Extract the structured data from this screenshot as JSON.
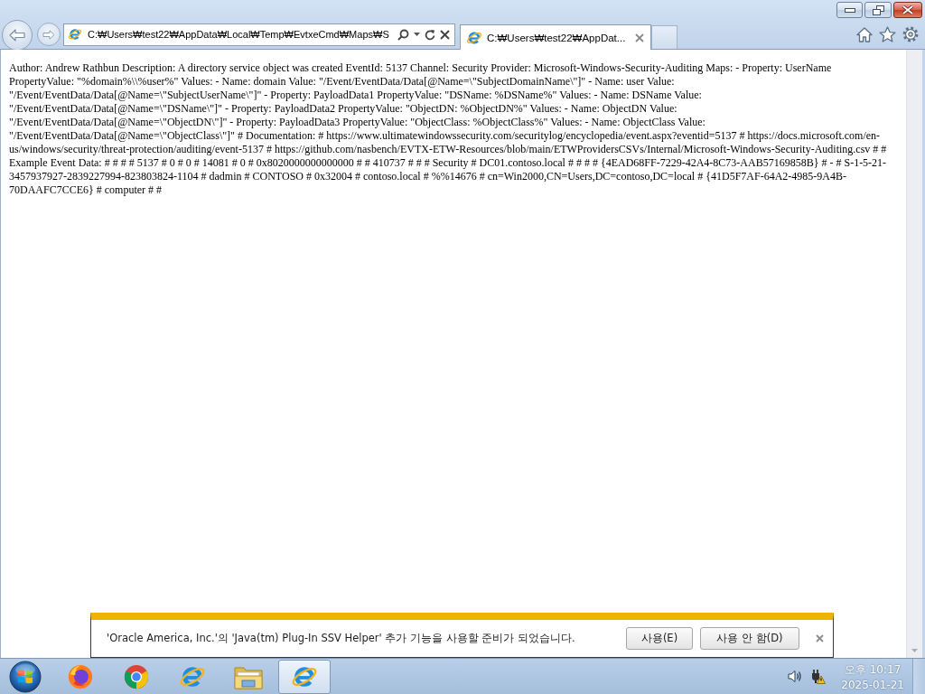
{
  "address_bar": {
    "value": "C:₩Users₩test22₩AppData₩Local₩Temp₩EvtxeCmd₩Maps₩S"
  },
  "tabs": [
    {
      "label": "C:₩Users₩test22₩AppDat...",
      "selected": true
    }
  ],
  "document": {
    "text": "Author: Andrew Rathbun Description: A directory service object was created EventId: 5137 Channel: Security Provider: Microsoft-Windows-Security-Auditing Maps: - Property: UserName PropertyValue: \"%domain%\\\\%user%\" Values: - Name: domain Value: \"/Event/EventData/Data[@Name=\\\"SubjectDomainName\\\"]\" - Name: user Value: \"/Event/EventData/Data[@Name=\\\"SubjectUserName\\\"]\" - Property: PayloadData1 PropertyValue: \"DSName: %DSName%\" Values: - Name: DSName Value: \"/Event/EventData/Data[@Name=\\\"DSName\\\"]\" - Property: PayloadData2 PropertyValue: \"ObjectDN: %ObjectDN%\" Values: - Name: ObjectDN Value: \"/Event/EventData/Data[@Name=\\\"ObjectDN\\\"]\" - Property: PayloadData3 PropertyValue: \"ObjectClass: %ObjectClass%\" Values: - Name: ObjectClass Value: \"/Event/EventData/Data[@Name=\\\"ObjectClass\\\"]\" # Documentation: # https://www.ultimatewindowssecurity.com/securitylog/encyclopedia/event.aspx?eventid=5137 # https://docs.microsoft.com/en-us/windows/security/threat-protection/auditing/event-5137 # https://github.com/nasbench/EVTX-ETW-Resources/blob/main/ETWProvidersCSVs/Internal/Microsoft-Windows-Security-Auditing.csv # # Example Event Data: # # # # 5137 # 0 # 0 # 14081 # 0 # 0x8020000000000000 # # 410737 # # # Security # DC01.contoso.local # # # # {4EAD68FF-7229-42A4-8C73-AAB57169858B} # - # S-1-5-21-3457937927-2839227994-823803824-1104 # dadmin # CONTOSO # 0x32004 # contoso.local # %%14676 # cn=Win2000,CN=Users,DC=contoso,DC=local # {41D5F7AF-64A2-4985-9A4B-70DAAFC7CCE6} # computer # #"
  },
  "notification": {
    "message": "'Oracle America, Inc.'의 'Java(tm) Plug-In SSV Helper' 추가 기능을 사용할 준비가 되었습니다.",
    "buttons": [
      "사용(E)",
      "사용 안 함(D)"
    ]
  },
  "taskbar": {
    "apps": [
      {
        "kind": "fox",
        "selected": false
      },
      {
        "kind": "ring",
        "selected": false
      },
      {
        "kind": "e",
        "selected": false
      },
      {
        "kind": "folder",
        "selected": false
      },
      {
        "kind": "e",
        "selected": true
      }
    ],
    "clock": {
      "time": "오후 10:17",
      "date": "2025-01-21"
    }
  }
}
